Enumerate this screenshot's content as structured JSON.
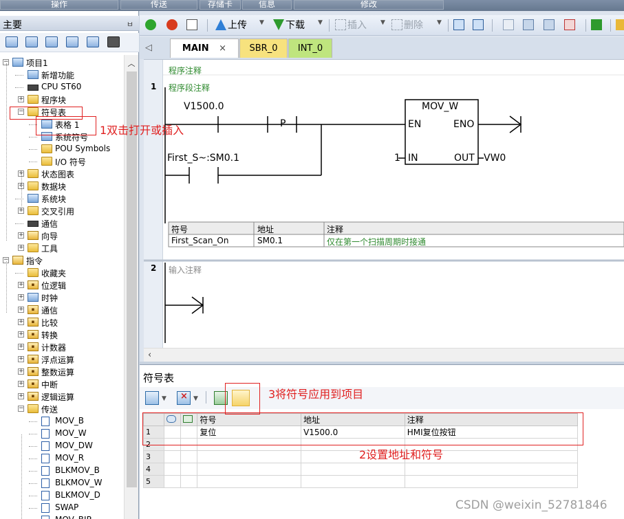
{
  "top_tabs": [
    "操作",
    "传送",
    "存储卡",
    "信息",
    "修改"
  ],
  "left_panel": {
    "title": "主要",
    "pin": "ㅂ",
    "tree": [
      {
        "label": "项目1",
        "indent": 0,
        "box": "−",
        "icon": "project-icon"
      },
      {
        "label": "新增功能",
        "indent": 1,
        "box": "",
        "icon": "help-icon"
      },
      {
        "label": "CPU ST60",
        "indent": 1,
        "box": "",
        "icon": "cpu-icon"
      },
      {
        "label": "程序块",
        "indent": 1,
        "box": "+",
        "icon": "folder-icon"
      },
      {
        "label": "符号表",
        "indent": 1,
        "box": "−",
        "icon": "folder-icon"
      },
      {
        "label": "表格 1",
        "indent": 2,
        "box": "",
        "icon": "table-icon"
      },
      {
        "label": "系统符号",
        "indent": 2,
        "box": "",
        "icon": "table-icon"
      },
      {
        "label": "POU Symbols",
        "indent": 2,
        "box": "",
        "icon": "pou-icon"
      },
      {
        "label": "I/O 符号",
        "indent": 2,
        "box": "",
        "icon": "pou-icon"
      },
      {
        "label": "状态图表",
        "indent": 1,
        "box": "+",
        "icon": "folder-icon"
      },
      {
        "label": "数据块",
        "indent": 1,
        "box": "+",
        "icon": "folder-icon"
      },
      {
        "label": "系统块",
        "indent": 1,
        "box": "",
        "icon": "doc-icon"
      },
      {
        "label": "交叉引用",
        "indent": 1,
        "box": "+",
        "icon": "folder-icon"
      },
      {
        "label": "通信",
        "indent": 1,
        "box": "",
        "icon": "monitor-icon"
      },
      {
        "label": "向导",
        "indent": 1,
        "box": "+",
        "icon": "wizard-icon"
      },
      {
        "label": "工具",
        "indent": 1,
        "box": "+",
        "icon": "folder-icon"
      },
      {
        "label": "指令",
        "indent": 0,
        "box": "−",
        "icon": "instructions-icon"
      },
      {
        "label": "收藏夹",
        "indent": 1,
        "box": "",
        "icon": "folder-icon"
      },
      {
        "label": "位逻辑",
        "indent": 1,
        "box": "+",
        "icon": "inst-icon"
      },
      {
        "label": "时钟",
        "indent": 1,
        "box": "+",
        "icon": "clock-icon"
      },
      {
        "label": "通信",
        "indent": 1,
        "box": "+",
        "icon": "inst-icon"
      },
      {
        "label": "比较",
        "indent": 1,
        "box": "+",
        "icon": "inst-icon"
      },
      {
        "label": "转换",
        "indent": 1,
        "box": "+",
        "icon": "inst-icon"
      },
      {
        "label": "计数器",
        "indent": 1,
        "box": "+",
        "icon": "inst-icon"
      },
      {
        "label": "浮点运算",
        "indent": 1,
        "box": "+",
        "icon": "inst-icon"
      },
      {
        "label": "整数运算",
        "indent": 1,
        "box": "+",
        "icon": "inst-icon"
      },
      {
        "label": "中断",
        "indent": 1,
        "box": "+",
        "icon": "inst-icon"
      },
      {
        "label": "逻辑运算",
        "indent": 1,
        "box": "+",
        "icon": "inst-icon"
      },
      {
        "label": "传送",
        "indent": 1,
        "box": "−",
        "icon": "folder-icon"
      },
      {
        "label": "MOV_B",
        "indent": 2,
        "box": "",
        "icon": "mov-icon"
      },
      {
        "label": "MOV_W",
        "indent": 2,
        "box": "",
        "icon": "mov-icon"
      },
      {
        "label": "MOV_DW",
        "indent": 2,
        "box": "",
        "icon": "mov-icon"
      },
      {
        "label": "MOV_R",
        "indent": 2,
        "box": "",
        "icon": "mov-icon"
      },
      {
        "label": "BLKMOV_B",
        "indent": 2,
        "box": "",
        "icon": "mov-icon"
      },
      {
        "label": "BLKMOV_W",
        "indent": 2,
        "box": "",
        "icon": "mov-icon"
      },
      {
        "label": "BLKMOV_D",
        "indent": 2,
        "box": "",
        "icon": "mov-icon"
      },
      {
        "label": "SWAP",
        "indent": 2,
        "box": "",
        "icon": "mov-icon"
      },
      {
        "label": "MOV_BIR",
        "indent": 2,
        "box": "",
        "icon": "mov-icon"
      }
    ]
  },
  "toolbar": {
    "upload": "上传",
    "download": "下载",
    "insert": "插入",
    "delete": "删除"
  },
  "editor_tabs": [
    {
      "label": "MAIN",
      "close": "×"
    },
    {
      "label": "SBR_0"
    },
    {
      "label": "INT_0"
    }
  ],
  "ladder": {
    "program_comment": "程序注释",
    "network1": {
      "number": "1",
      "comment": "程序段注释",
      "contact1": "V1500.0",
      "p_label": "P",
      "contact2": "First_S~:SM0.1",
      "box_title": "MOV_W",
      "en": "EN",
      "eno": "ENO",
      "in_label": "IN",
      "out_label": "OUT",
      "in_value": "1",
      "out_value": "VW0",
      "sym_headers": [
        "符号",
        "地址",
        "注释"
      ],
      "sym_row": [
        "First_Scan_On",
        "SM0.1",
        "仅在第一个扫描周期时接通"
      ]
    },
    "network2": {
      "number": "2",
      "comment": "输入注释"
    }
  },
  "symbol_table": {
    "title": "符号表",
    "headers": [
      "符号",
      "地址",
      "注释"
    ],
    "rows": [
      {
        "n": "1",
        "symbol": "复位",
        "address": "V1500.0",
        "comment": "HMI复位按钮"
      },
      {
        "n": "2",
        "symbol": "",
        "address": "",
        "comment": ""
      },
      {
        "n": "3",
        "symbol": "",
        "address": "",
        "comment": ""
      },
      {
        "n": "4",
        "symbol": "",
        "address": "",
        "comment": ""
      },
      {
        "n": "5",
        "symbol": "",
        "address": "",
        "comment": ""
      }
    ]
  },
  "annotations": {
    "step1": "1双击打开或插入",
    "step2": "2设置地址和符号",
    "step3": "3将符号应用到项目"
  },
  "watermark": "CSDN @weixin_52781846",
  "colors": {
    "annotation_red": "#e02020",
    "tab_main": "#ffffff",
    "tab_sbr": "#f7e27e",
    "tab_int": "#bfe57e",
    "comment_green": "#2f8a2f"
  }
}
